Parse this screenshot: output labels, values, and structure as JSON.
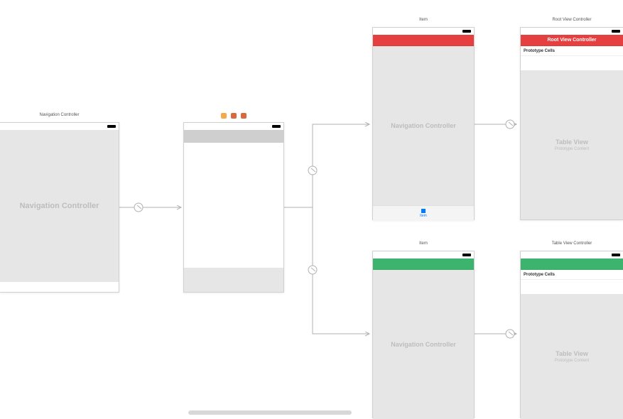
{
  "scenes": {
    "nav1": {
      "title": "Navigation Controller",
      "body_label": "Navigation Controller"
    },
    "vc1": {
      "title": "",
      "body_label": ""
    },
    "nav_red": {
      "title": "Item",
      "body_label": "Navigation Controller",
      "tabbar_label": "Item",
      "navbar_color": "#e5403f"
    },
    "tv_red": {
      "title": "Root View Controller",
      "navbar_label": "Root View Controller",
      "proto_label": "Prototype Cells",
      "body_label": "Table View",
      "body_sublabel": "Prototype Content",
      "navbar_color": "#e5403f"
    },
    "nav_green": {
      "title": "Item",
      "body_label": "Navigation Controller",
      "navbar_color": "#3cb46e"
    },
    "tv_green": {
      "title": "Table View Controller",
      "proto_label": "Prototype Cells",
      "body_label": "Table View",
      "body_sublabel": "Prototype Content",
      "navbar_color": "#3cb46e"
    }
  },
  "icons": {
    "dock_left": "◧",
    "dock_close": "✕",
    "dock_menu": "≡"
  }
}
